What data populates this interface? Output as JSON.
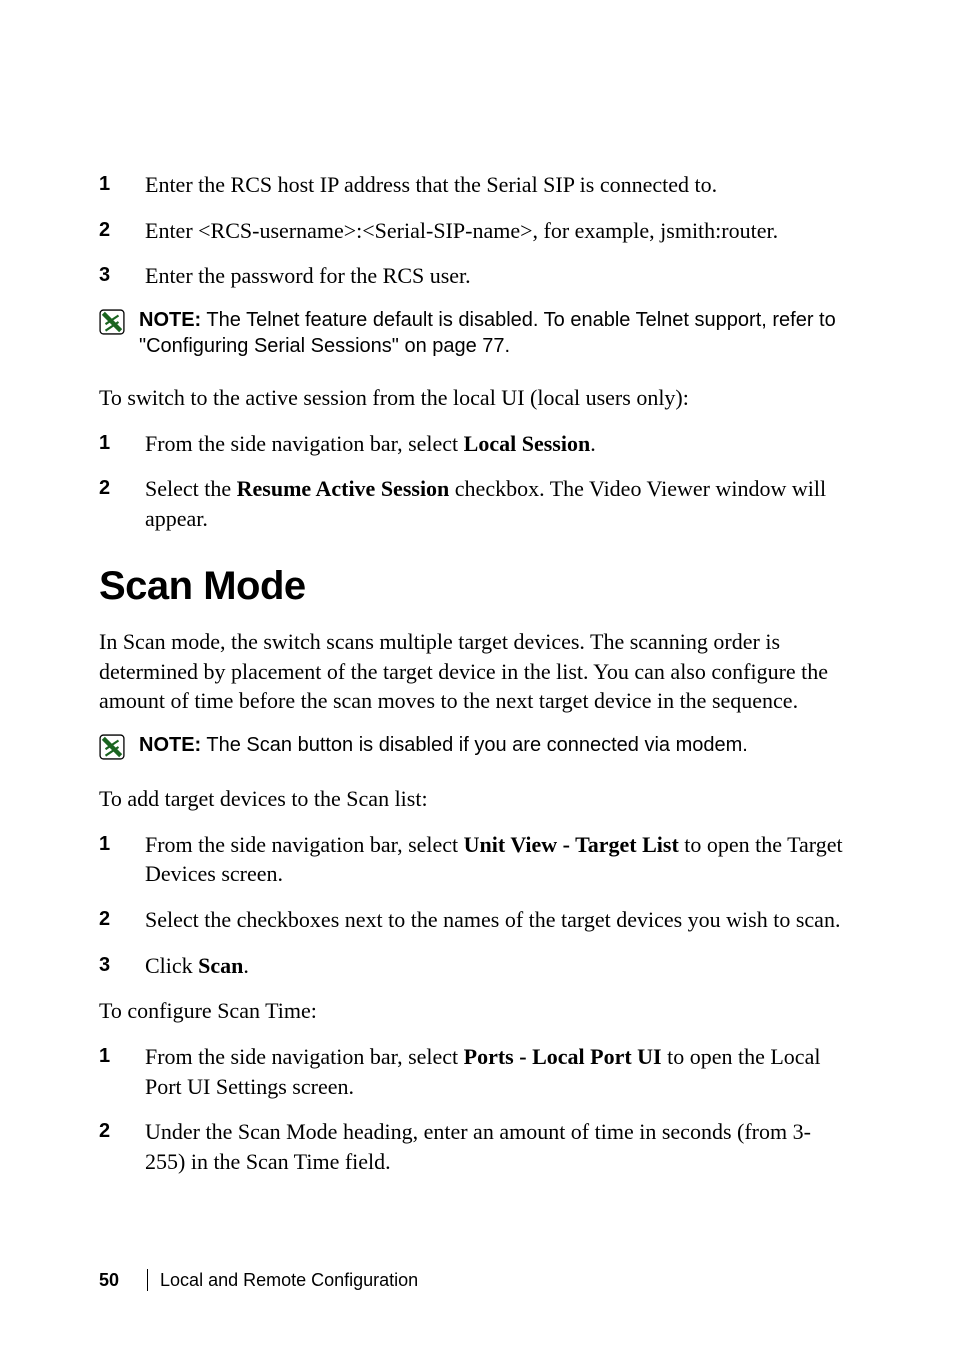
{
  "list1": {
    "i1": {
      "num": "1",
      "text": "Enter the RCS host IP address that the Serial SIP is connected to."
    },
    "i2": {
      "num": "2",
      "text": "Enter <RCS-username>:<Serial-SIP-name>, for example, jsmith:router."
    },
    "i3": {
      "num": "3",
      "text": "Enter the password for the RCS user."
    }
  },
  "note1": {
    "label": "NOTE:",
    "text": " The Telnet feature default is disabled. To enable Telnet support, refer to \"Configuring Serial Sessions\" on page 77."
  },
  "para1": "To switch to the active session from the local UI (local users only):",
  "list2": {
    "i1": {
      "num": "1",
      "pre": "From the side navigation bar, select ",
      "bold": "Local Session",
      "post": "."
    },
    "i2": {
      "num": "2",
      "pre": "Select the ",
      "bold": "Resume Active Session",
      "post": " checkbox. The Video Viewer window will appear."
    }
  },
  "heading": "Scan Mode",
  "para2": "In Scan mode, the switch scans multiple target devices. The scanning order is determined by placement of the target device in the list. You can also configure the amount of time before the scan moves to the next target device in the sequence.",
  "note2": {
    "label": "NOTE:",
    "text": " The Scan button is disabled if you are connected via modem."
  },
  "para3": "To add target devices to the Scan list:",
  "list3": {
    "i1": {
      "num": "1",
      "pre": "From the side navigation bar, select ",
      "bold": "Unit View - Target List",
      "post": " to open the Target Devices screen."
    },
    "i2": {
      "num": "2",
      "text": "Select the checkboxes next to the names of the target devices you wish to scan."
    },
    "i3": {
      "num": "3",
      "pre": "Click ",
      "bold": "Scan",
      "post": "."
    }
  },
  "para4": "To configure Scan Time:",
  "list4": {
    "i1": {
      "num": "1",
      "pre": "From the side navigation bar, select ",
      "bold": "Ports - Local Port UI",
      "post": " to open the Local Port UI Settings screen."
    },
    "i2": {
      "num": "2",
      "text": "Under the Scan Mode heading, enter an amount of time in seconds (from 3-255) in the Scan Time field."
    }
  },
  "footer": {
    "page": "50",
    "section": "Local and Remote Configuration"
  }
}
